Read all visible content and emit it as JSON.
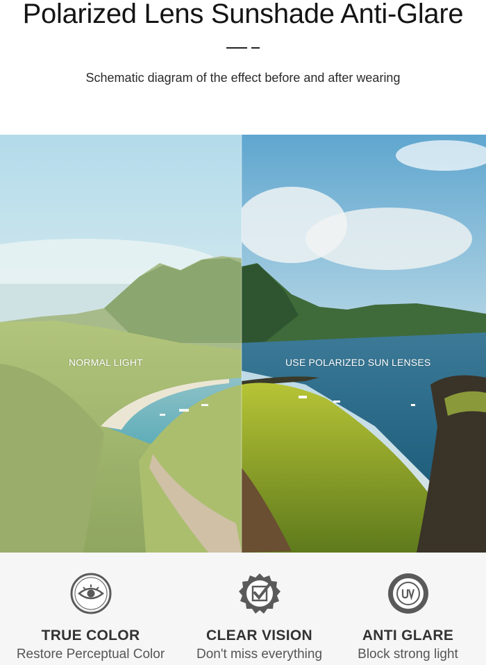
{
  "header": {
    "title": "Polarized Lens Sunshade Anti-Glare",
    "subtitle": "Schematic diagram of the effect before and after wearing"
  },
  "comparison": {
    "left_label": "NORMAL LIGHT",
    "right_label": "USE POLARIZED SUN LENSES"
  },
  "features": [
    {
      "icon": "eye-icon",
      "name": "TRUE COLOR",
      "desc": "Restore Perceptual Color"
    },
    {
      "icon": "check-badge-icon",
      "name": "CLEAR VISION",
      "desc": "Don't miss everything"
    },
    {
      "icon": "uv-icon",
      "name": "ANTI GLARE",
      "desc": "Block strong light"
    }
  ],
  "colors": {
    "feature_bg": "#f6f6f6",
    "icon_gray": "#5a5a5a"
  }
}
